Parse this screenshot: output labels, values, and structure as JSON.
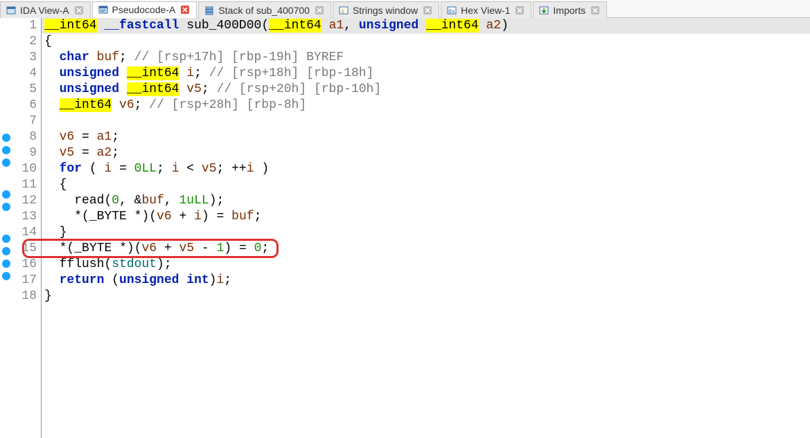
{
  "tabs": [
    {
      "label": "IDA View-A",
      "active": false,
      "close": "gray",
      "icon": "viewA"
    },
    {
      "label": "Pseudocode-A",
      "active": true,
      "close": "red",
      "icon": "pseudo"
    },
    {
      "label": "Stack of sub_400700",
      "active": false,
      "close": "gray",
      "icon": "stack"
    },
    {
      "label": "Strings window",
      "active": false,
      "close": "gray",
      "icon": "strings"
    },
    {
      "label": "Hex View-1",
      "active": false,
      "close": "gray",
      "icon": "hex"
    },
    {
      "label": "Imports",
      "active": false,
      "close": "gray",
      "icon": "imports"
    }
  ],
  "code": {
    "lines": [
      {
        "n": 1,
        "bp": false
      },
      {
        "n": 2,
        "bp": false
      },
      {
        "n": 3,
        "bp": false
      },
      {
        "n": 4,
        "bp": false
      },
      {
        "n": 5,
        "bp": false
      },
      {
        "n": 6,
        "bp": false
      },
      {
        "n": 7,
        "bp": false
      },
      {
        "n": 8,
        "bp": true
      },
      {
        "n": 9,
        "bp": true
      },
      {
        "n": 10,
        "bp": true
      },
      {
        "n": 11,
        "bp": false
      },
      {
        "n": 12,
        "bp": true
      },
      {
        "n": 13,
        "bp": true
      },
      {
        "n": 14,
        "bp": false
      },
      {
        "n": 15,
        "bp": true
      },
      {
        "n": 16,
        "bp": true
      },
      {
        "n": 17,
        "bp": true
      },
      {
        "n": 18,
        "bp": true
      }
    ],
    "tokens": {
      "int64": "__int64",
      "fastcall": "__fastcall",
      "sub": "sub_400D00",
      "a1": "a1",
      "unsigned": "unsigned",
      "a2": "a2",
      "char": "char",
      "buf": "buf",
      "c3": "// [rsp+17h] [rbp-19h] BYREF",
      "i": "i",
      "c4": "// [rsp+18h] [rbp-18h]",
      "v5": "v5",
      "c5": "// [rsp+20h] [rbp-10h]",
      "v6": "v6",
      "c6": "// [rsp+28h] [rbp-8h]",
      "for": "for",
      "zeroLL": "0LL",
      "read": "read",
      "one_ull": "1uLL",
      "byte": "_BYTE",
      "zero": "0",
      "one": "1",
      "fflush": "fflush",
      "stdout": "stdout",
      "return": "return",
      "uint": "unsigned int",
      "open_brace": "{",
      "close_brace": "}",
      "semi": ";",
      "comma_sp": ", ",
      "star": "*",
      "amp": "&",
      "eq": " = ",
      "lt": " < ",
      "plus": " + ",
      "minus": " - ",
      "inc": "++",
      "lparen": "(",
      "rparen": ")"
    }
  },
  "highlight_line": 15
}
